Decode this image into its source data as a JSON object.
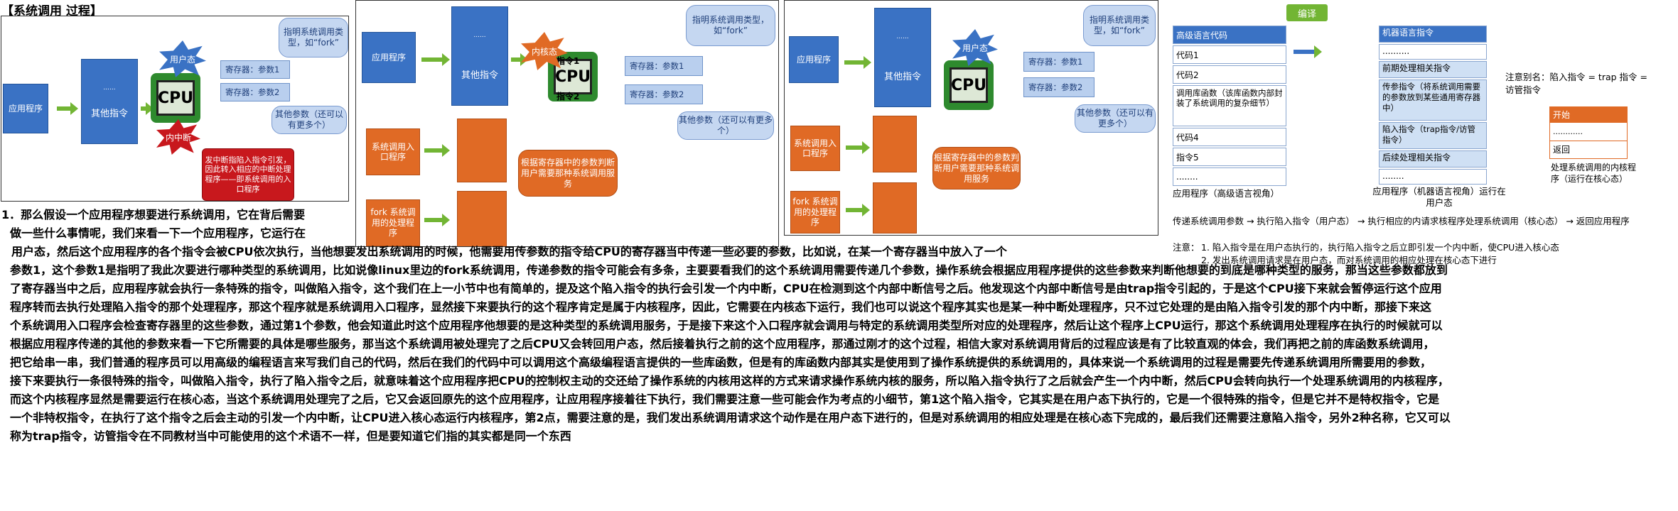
{
  "title": "【系统调用 过程】",
  "panel1": {
    "app": "应用程序",
    "other": "其他指令",
    "dots": "......",
    "user_state": "用户态",
    "kernel_interrupt": "内中断",
    "reg1": "寄存器：参数1",
    "reg2": "寄存器：参数2",
    "callout_top": "指明系统调用类型，如“fork”",
    "callout_other": "其他参数（还可以有更多个）",
    "callout_red": "发中断指陷入指令引发，因此转入相应的中断处理程序——即系统调用的入口程序",
    "cpu": "CPU"
  },
  "panel2": {
    "app": "应用程序",
    "other": "其他指令",
    "dots": "......",
    "entry": "系统调用入口程序",
    "fork": "fork 系统调用的处理程序",
    "kernel_state": "内核态",
    "instr1": "指令1",
    "instr2": "指令2",
    "reg1": "寄存器：参数1",
    "reg2": "寄存器：参数2",
    "callout_top": "指明系统调用类型，如“fork”",
    "callout_other": "其他参数（还可以有更多个）",
    "callout_orange": "根据寄存器中的参数判断用户需要那种系统调用服务",
    "cpu": "CPU"
  },
  "panel3": {
    "app": "应用程序",
    "other": "其他指令",
    "dots": "......",
    "entry": "系统调用入口程序",
    "fork": "fork 系统调用的处理程序",
    "user_state": "用户态",
    "reg1": "寄存器：参数1",
    "reg2": "寄存器：参数2",
    "callout_top": "指明系统调用类型，如“fork”",
    "callout_other": "其他参数（还可以有更多个）",
    "callout_orange": "根据寄存器中的参数判断用户需要那种系统调用服务",
    "cpu": "CPU"
  },
  "panel4": {
    "compile": "编译",
    "hl_header": "高级语言代码",
    "hl_rows": [
      "代码1",
      "代码2",
      "调用库函数（该库函数内部封装了系统调用的复杂细节）",
      "代码4",
      "指令5",
      "........"
    ],
    "ml_header": "机器语言指令",
    "ml_rows": [
      "..........",
      "前期处理相关指令",
      "传参指令（将系统调用需要的参数放到某些通用寄存器中）",
      "陷入指令（trap指令/访管指令）",
      "后续处理相关指令",
      "........"
    ],
    "app_hl": "应用程序（高级语言视角）",
    "app_ml": "应用程序（机器语言视角）运行在用户态",
    "alias": "注意别名：陷入指令 = trap 指令 = 访管指令",
    "start": "开始",
    "dots": "............",
    "ret": "返回",
    "kernel_prog": "处理系统调用的内核程序（运行在核心态）",
    "flow": "传递系统调用参数 → 执行陷入指令（用户态） → 执行相应的内请求核程序处理系统调用（核心态） → 返回应用程序",
    "note_head": "注意：",
    "note1": "1. 陷入指令是在用户态执行的，执行陷入指令之后立即引发一个内中断，使CPU进入核心态",
    "note2": "2. 发出系统调用请求是在用户态，而对系统调用的相应处理在核心态下进行"
  },
  "paragraph": [
    "1．那么假设一个应用程序想要进行系统调用，它在背后需要",
    "做一些什么事情呢，我们来看一下一个应用程序，它运行在",
    "用户态，然后这个应用程序的各个指令会被CPU依次执行，当他想要发出系统调用的时候，他需要用传参数的指令给CPU的寄存器当中传递一些必要的参数，比如说，在某一个寄存器当中放入了一个",
    "参数1，这个参数1是指明了我此次要进行哪种类型的系统调用，比如说像linux里边的fork系统调用，传递参数的指令可能会有多条，主要要看我们的这个系统调用需要传递几个参数，操作系统会根据应用程序提供的这些参数来判断他想要的到底是哪种类型的服务，那当这些参数都放到",
    "了寄存器当中之后，应用程序就会执行一条特殊的指令，叫做陷入指令，这个我们在上一小节中也有简单的，提及这个陷入指令的执行会引发一个内中断，CPU在检测到这个内部中断信号之后。他发现这个内部中断信号是由trap指令引起的，于是这个CPU接下来就会暂停运行这个应用",
    "程序转而去执行处理陷入指令的那个处理程序，那这个程序就是系统调用入口程序，显然接下来要执行的这个程序肯定是属于内核程序，因此，它需要在内核态下运行，我们也可以说这个程序其实也是某一种中断处理程序，只不过它处理的是由陷入指令引发的那个内中断，那接下来这",
    "个系统调用入口程序会检查寄存器里的这些参数，通过第1个参数，他会知道此时这个应用程序他想要的是这种类型的系统调用服务，于是接下来这个入口程序就会调用与特定的系统调用类型所对应的处理程序，然后让这个程序上CPU运行，那这个系统调用处理程序在执行的时候就可以",
    "根据应用程序传递的其他的参数来看一下它所需要的具体是哪些服务，那当这个系统调用被处理完了之后CPU又会转回用户态，然后接着执行之前的这个应用程序，那通过刚才的这个过程，相信大家对系统调用背后的过程应该是有了比较直观的体会，我们再把之前的库函数系统调用，",
    "把它给串一串，我们普通的程序员可以用高级的编程语言来写我们自己的代码，然后在我们的代码中可以调用这个高级编程语言提供的一些库函数，但是有的库函数内部其实是使用到了操作系统提供的系统调用的，具体来说一个系统调用的过程是需要先传递系统调用所需要用的参数，",
    "接下来要执行一条很特殊的指令，叫做陷入指令，执行了陷入指令之后，就意味着这个应用程序把CPU的控制权主动的交还给了操作系统的内核用这样的方式来请求操作系统内核的服务，所以陷入指令执行了之后就会产生一个内中断，然后CPU会转向执行一个处理系统调用的内核程序，",
    "而这个内核程序显然是需要运行在核心态，当这个系统调用处理完了之后，它又会返回原先的这个应用程序，让应用程序接着往下执行，我们需要注意一些可能会作为考点的小细节，第1这个陷入指令，它其实是在用户态下执行的，它是一个很特殊的指令，但是它并不是特权指令，它是",
    "一个非特权指令，在执行了这个指令之后会主动的引发一个内中断，让CPU进入核心态运行内核程序，第2点，需要注意的是，我们发出系统调用请求这个动作是在用户态下进行的，但是对系统调用的相应处理是在核心态下完成的，最后我们还需要注意陷入指令，另外2种名称，它又可以",
    "称为trap指令，访管指令在不同教材当中可能使用的这个术语不一样，但是要知道它们指的其实都是同一个东西"
  ]
}
